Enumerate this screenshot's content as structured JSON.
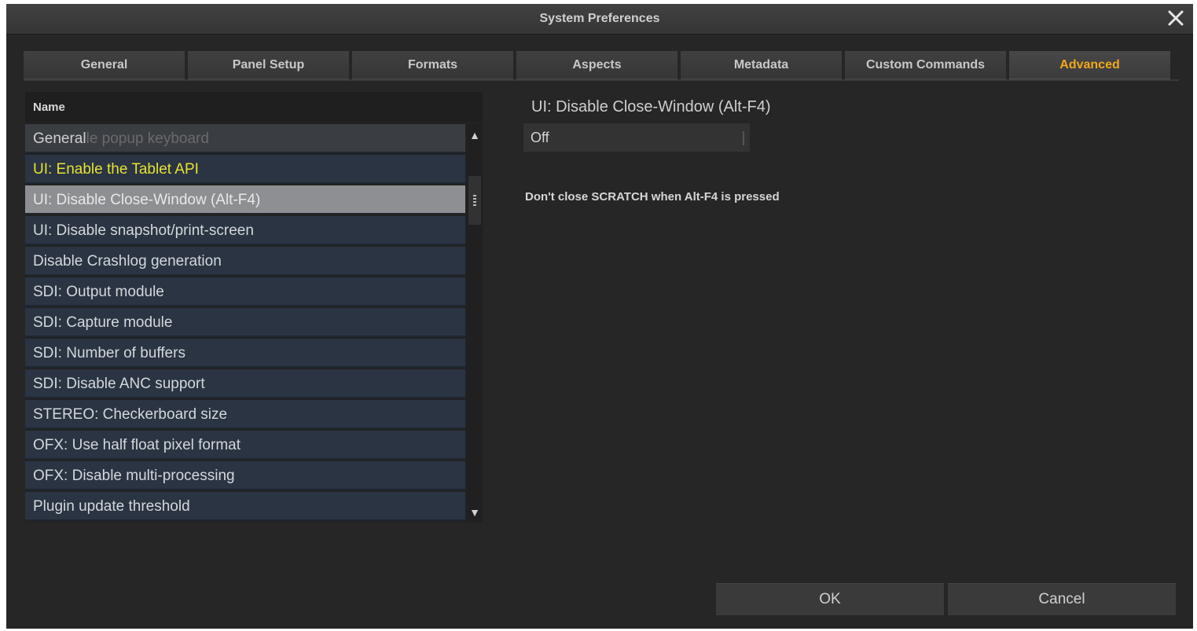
{
  "window": {
    "title": "System Preferences"
  },
  "tabs": [
    {
      "label": "General"
    },
    {
      "label": "Panel Setup"
    },
    {
      "label": "Formats"
    },
    {
      "label": "Aspects"
    },
    {
      "label": "Metadata"
    },
    {
      "label": "Custom Commands"
    },
    {
      "label": "Advanced"
    }
  ],
  "active_tab": "Advanced",
  "list": {
    "column_header": "Name",
    "first_row": {
      "label": "General",
      "ghost": "le popup keyboard"
    },
    "items": [
      {
        "label": "UI: Enable the Tablet API"
      },
      {
        "label": "UI: Disable Close-Window (Alt-F4)"
      },
      {
        "label": "UI: Disable snapshot/print-screen"
      },
      {
        "label": "Disable Crashlog generation"
      },
      {
        "label": "SDI: Output module"
      },
      {
        "label": "SDI: Capture module"
      },
      {
        "label": "SDI: Number of buffers"
      },
      {
        "label": "SDI: Disable ANC support"
      },
      {
        "label": "STEREO: Checkerboard size"
      },
      {
        "label": "OFX: Use half float pixel format"
      },
      {
        "label": "OFX: Disable multi-processing"
      },
      {
        "label": "Plugin update threshold"
      }
    ],
    "selected": "UI: Disable Close-Window (Alt-F4)",
    "highlighted": "UI: Enable the Tablet API"
  },
  "detail": {
    "setting_title": "UI: Disable Close-Window (Alt-F4)",
    "value": "Off",
    "description": "Don't close SCRATCH when Alt-F4 is pressed"
  },
  "buttons": {
    "ok": "OK",
    "cancel": "Cancel"
  },
  "colors": {
    "active_tab": "#f0a81c",
    "highlight_item": "#e6e233",
    "row_background": "#2a3442",
    "selected_row": "#8d8f92"
  },
  "icons": {
    "close": "close-icon",
    "scroll_up": "arrow-up-icon",
    "scroll_down": "arrow-down-icon"
  }
}
